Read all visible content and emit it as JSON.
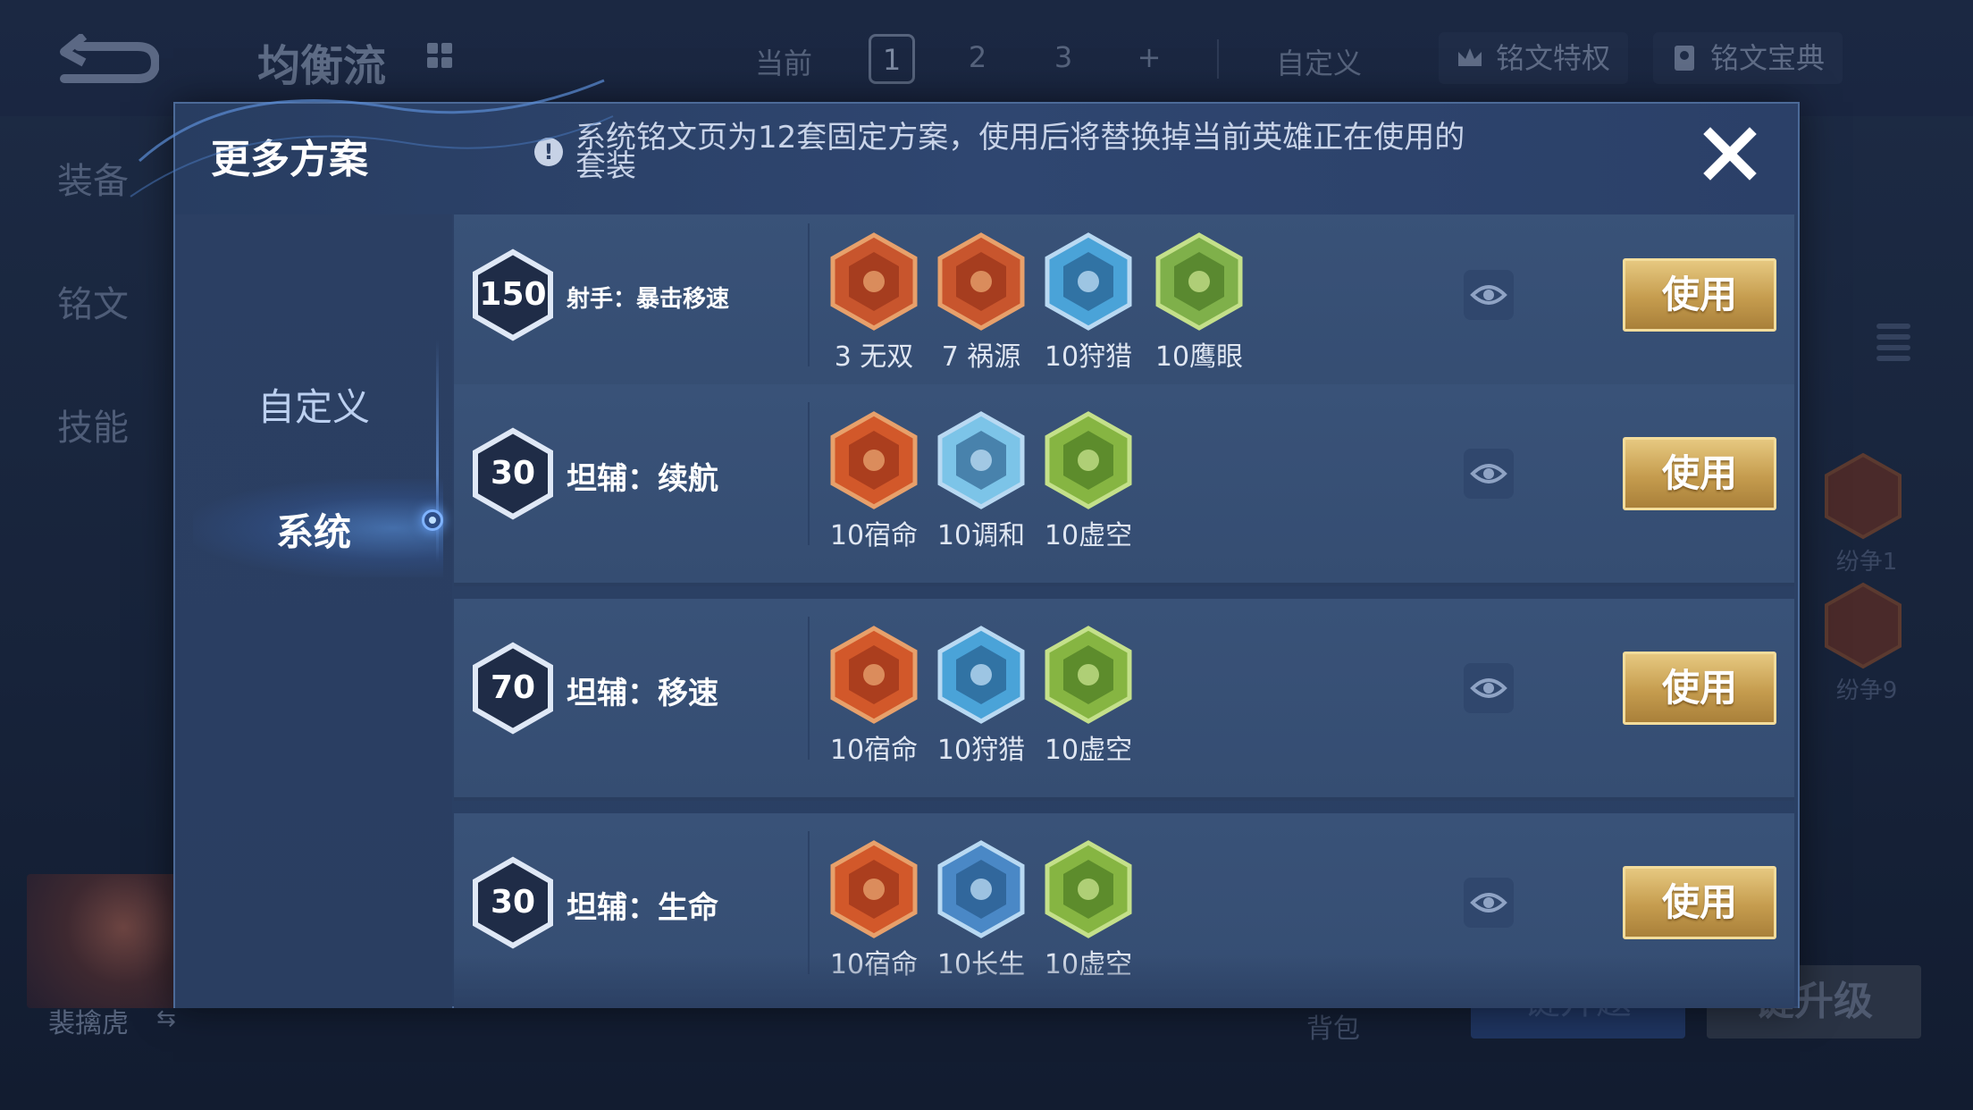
{
  "background": {
    "title": "均衡流",
    "current_label": "当前",
    "pages": [
      "1",
      "2",
      "3",
      "+"
    ],
    "active_page": "1",
    "custom_label": "自定义",
    "privilege_label": "铭文特权",
    "codex_label": "铭文宝典",
    "side_nav": [
      "装备",
      "铭文",
      "技能"
    ],
    "right_badges": [
      "纷争1",
      "纷争9"
    ],
    "hero_name": "裴擒虎",
    "bag_label": "背包",
    "btn_left": "键升题",
    "btn_right": "键升级"
  },
  "dialog": {
    "title": "更多方案",
    "notice": "系统铭文页为12套固定方案，使用后将替换掉当前英雄正在使用的套装",
    "side_tabs": [
      {
        "label": "自定义",
        "active": false
      },
      {
        "label": "系统",
        "active": true
      }
    ],
    "use_label": "使用",
    "presets": [
      {
        "level": "150",
        "name": "射手：暴击移速",
        "runes": [
          {
            "label": "3 无双",
            "color": "#c8552d",
            "kind": "red"
          },
          {
            "label": "7 祸源",
            "color": "#c8552d",
            "kind": "red"
          },
          {
            "label": "10狩猎",
            "color": "#4aa3d8",
            "kind": "blue"
          },
          {
            "label": "10鹰眼",
            "color": "#7fb04a",
            "kind": "green"
          }
        ]
      },
      {
        "level": "30",
        "name": "坦辅：续航",
        "runes": [
          {
            "label": "10宿命",
            "color": "#d2582a",
            "kind": "red"
          },
          {
            "label": "10调和",
            "color": "#7cc4e8",
            "kind": "blue"
          },
          {
            "label": "10虚空",
            "color": "#86b542",
            "kind": "green"
          }
        ]
      },
      {
        "level": "70",
        "name": "坦辅：移速",
        "runes": [
          {
            "label": "10宿命",
            "color": "#d2582a",
            "kind": "red"
          },
          {
            "label": "10狩猎",
            "color": "#4aa3d8",
            "kind": "blue"
          },
          {
            "label": "10虚空",
            "color": "#86b542",
            "kind": "green"
          }
        ]
      },
      {
        "level": "30",
        "name": "坦辅：生命",
        "runes": [
          {
            "label": "10宿命",
            "color": "#d2582a",
            "kind": "red"
          },
          {
            "label": "10长生",
            "color": "#4a88c6",
            "kind": "blue"
          },
          {
            "label": "10虚空",
            "color": "#86b542",
            "kind": "green"
          }
        ]
      }
    ]
  }
}
